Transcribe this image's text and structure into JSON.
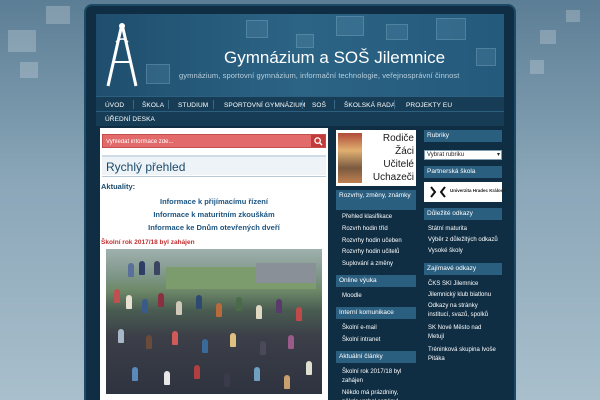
{
  "site": {
    "title": "Gymnázium a SOŠ Jilemnice",
    "subtitle": "gymnázium, sportovní gymnázium, informační technologie, veřejnosprávní činnost"
  },
  "nav": {
    "items": [
      {
        "label": "Úvod"
      },
      {
        "label": "Škola"
      },
      {
        "label": "Studium"
      },
      {
        "label": "Sportovní gymnázium"
      },
      {
        "label": "SOŠ"
      },
      {
        "label": "Školská rada"
      },
      {
        "label": "Projekty EU"
      },
      {
        "label": "Úřední deska"
      }
    ]
  },
  "search": {
    "placeholder": "Vyhledat informace zde..."
  },
  "main": {
    "quick_title": "Rychlý přehled",
    "news_label": "Aktuality:",
    "links": [
      "Informace k přijímacímu řízení",
      "Informace k maturitním zkouškám",
      "Informace ke Dnům otevřených dveří"
    ],
    "article_title": "Školní rok 2017/18 byl zahájen"
  },
  "promo": {
    "lines": [
      "Rodiče",
      "Žáci",
      "Učitelé",
      "Uchazeči"
    ]
  },
  "middle_sidebar": {
    "changes": {
      "title": "Rozvrhy, změny, známky",
      "links": [
        "Přehled klasifikace",
        "Rozvrh hodin tříd",
        "Rozvrhy hodin učeben",
        "Rozvrhy hodin učitelů",
        "Suplování a změny"
      ]
    },
    "online": {
      "title": "Online výuka",
      "links": [
        "Moodle"
      ]
    },
    "internal": {
      "title": "Interní komunikace",
      "links": [
        "Školní e-mail",
        "Školní intranet"
      ]
    },
    "articles": {
      "title": "Aktuální články",
      "links": [
        "Školní rok 2017/18 byl zahájen",
        "Někdo má prázdniny, někdo vrchol sezóny!"
      ]
    }
  },
  "right_sidebar": {
    "rubriky": {
      "title": "Rubriky",
      "select_value": "Vybrat rubriku"
    },
    "partner": {
      "title": "Partnerská škola",
      "logo_text": "Univerzita Hradec Králové"
    },
    "important": {
      "title": "Důležité odkazy",
      "links": [
        "Státní maturita",
        "Výběr z důležitých odkazů",
        "Vysoké školy"
      ]
    },
    "interesting": {
      "title": "Zajímavé odkazy",
      "links": [
        "ČKS SKI Jilemnice",
        "Jilemnický klub biatlonu",
        "Odkazy na stránky",
        "institucí, svazů, spolků",
        "SK Nové Město nad",
        "Metují",
        "Tréninková skupina Ivoše",
        "Pitáka"
      ]
    }
  },
  "colors": {
    "accent": "#e36a6a",
    "header_dark": "#0f2e44",
    "link": "#1e5580",
    "news_red": "#c03030"
  }
}
